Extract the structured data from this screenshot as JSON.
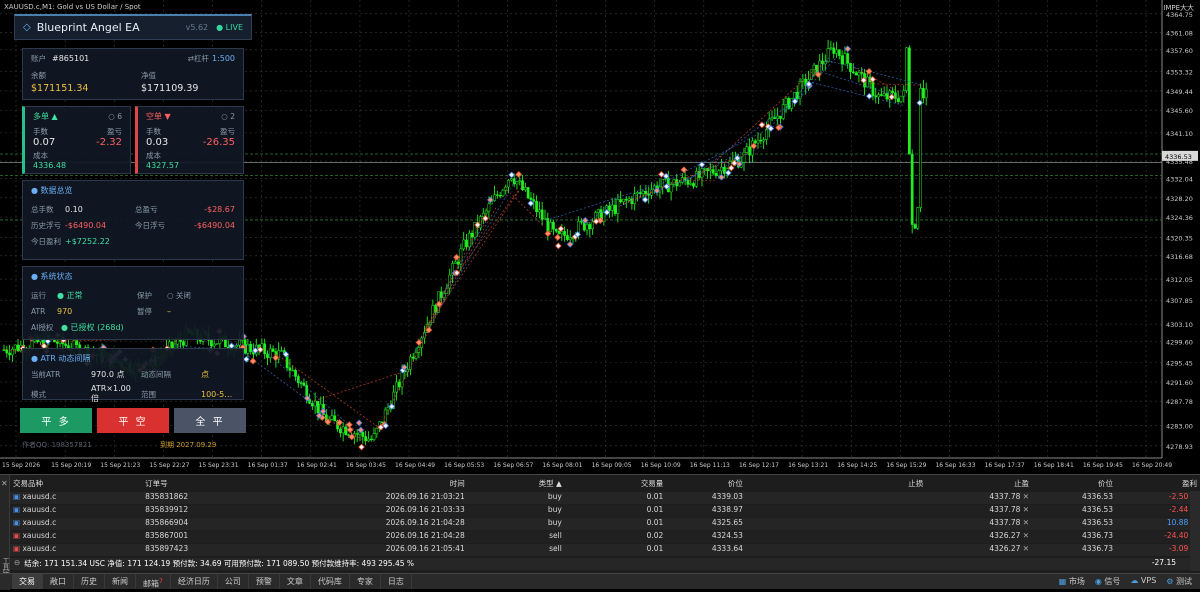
{
  "window": {
    "symbol_title": "XAUUSD.c,M1: Gold vs US Dollar / Spot",
    "top_right": "IMPE大大"
  },
  "ea": {
    "name": "Blueprint Angel EA",
    "version": "v5.62",
    "status": "● LIVE",
    "account_label": "账户",
    "account_no": "#865101",
    "leverage_label": "杠杆",
    "leverage": "1:500",
    "balance_label": "余额",
    "balance": "$171151.34",
    "equity_label": "净值",
    "equity": "$171109.39",
    "long": {
      "title": "多单 ▲",
      "count": "○ 6",
      "lots_label": "手数",
      "lots": "0.07",
      "pl_label": "盈亏",
      "pl": "-2.32",
      "cost_label": "成本",
      "cost": "4336.48"
    },
    "short": {
      "title": "空单 ▼",
      "count": "○ 2",
      "lots_label": "手数",
      "lots": "0.03",
      "pl_label": "盈亏",
      "pl": "-26.35",
      "cost_label": "成本",
      "cost": "4327.57"
    },
    "stats": {
      "title": "● 数据总览",
      "total_lots_label": "总手数",
      "total_lots": "0.10",
      "total_pl_label": "总盈亏",
      "total_pl": "-$28.67",
      "hist_label": "历史浮亏",
      "hist": "-$6490.04",
      "today_float_label": "今日浮亏",
      "today_float": "-$6490.04",
      "today_profit_label": "今日盈利",
      "today_profit": "+$7252.22"
    },
    "system": {
      "title": "● 系统状态",
      "run_label": "运行",
      "run": "● 正常",
      "protect_label": "保护",
      "protect": "○ 关闭",
      "atr_label": "ATR",
      "atr": "970",
      "pause_label": "暂停",
      "pause": "–",
      "ai_label": "AI授权",
      "ai": "● 已授权 (268d)"
    },
    "atr": {
      "title": "● ATR 动态间隔",
      "cur_label": "当前ATR",
      "cur": "970.0 点",
      "dyn_label": "动态间隔",
      "dyn": "点",
      "mode_label": "模式",
      "mode": "ATR×1.00 倍",
      "range_label": "范围",
      "range": "100-5…"
    },
    "buttons": {
      "close_long": "平 多",
      "close_short": "平 空",
      "close_all": "全 平"
    },
    "footer_author": "作者QQ: 198357821",
    "footer_expire": "到期 2027.09.29"
  },
  "chart_data": {
    "type": "candlestick",
    "symbol": "XAUUSD.c",
    "timeframe": "M1",
    "ylim": [
      4276.5,
      4367.5
    ],
    "price_ticks": [
      "4364.75",
      "4361.08",
      "4357.60",
      "4353.32",
      "4349.44",
      "4345.60",
      "4341.10",
      "4335.48",
      "4332.04",
      "4328.20",
      "4324.36",
      "4320.35",
      "4316.68",
      "4312.05",
      "4307.85",
      "4303.10",
      "4299.60",
      "4295.45",
      "4291.60",
      "4287.78",
      "4283.00",
      "4278.93"
    ],
    "time_ticks": [
      "15 Sep 2026",
      "15 Sep 20:19",
      "15 Sep 21:23",
      "15 Sep 22:27",
      "15 Sep 23:31",
      "16 Sep 01:37",
      "16 Sep 02:41",
      "16 Sep 03:45",
      "16 Sep 04:49",
      "16 Sep 05:53",
      "16 Sep 06:57",
      "16 Sep 08:01",
      "16 Sep 09:05",
      "16 Sep 10:09",
      "16 Sep 11:13",
      "16 Sep 12:17",
      "16 Sep 13:21",
      "16 Sep 14:25",
      "16 Sep 15:29",
      "16 Sep 16:33",
      "16 Sep 17:37",
      "16 Sep 18:41",
      "16 Sep 19:45",
      "16 Sep 20:49"
    ],
    "path_x": [
      0,
      5,
      10,
      15,
      20,
      25,
      30,
      35,
      40,
      45,
      50,
      55,
      60,
      65,
      70,
      75,
      80,
      85,
      90,
      95,
      100
    ],
    "path_y": [
      4298,
      4300,
      4297,
      4294,
      4301,
      4299,
      4297,
      4284,
      4280,
      4300,
      4319,
      4333,
      4320,
      4325,
      4330,
      4332,
      4336,
      4347,
      4358,
      4348,
      4349
    ],
    "current_price_label": "4336.53",
    "colors": {
      "candle": "#22ee22",
      "grid": "#3a3a3a",
      "buy_line": "#3a78d8",
      "sell_line": "#e0502a",
      "level_line": "#2e7d32"
    }
  },
  "terminal": {
    "headers": [
      "交易品种",
      "订单号",
      "时间",
      "类型 ▲",
      "交易量",
      "价位",
      "止损",
      "止盈",
      "价位",
      "盈利"
    ],
    "rows": [
      {
        "side": "buy",
        "sym": "xauusd.c",
        "order": "835831862",
        "time": "2026.09.16 21:03:21",
        "type": "buy",
        "vol": "0.01",
        "price": "4339.03",
        "sl": "",
        "tp": "4337.78",
        "cur": "4336.53",
        "profit": "-2.50"
      },
      {
        "side": "buy",
        "sym": "xauusd.c",
        "order": "835839912",
        "time": "2026.09.16 21:03:33",
        "type": "buy",
        "vol": "0.01",
        "price": "4338.97",
        "sl": "",
        "tp": "4337.78",
        "cur": "4336.53",
        "profit": "-2.44"
      },
      {
        "side": "buy",
        "sym": "xauusd.c",
        "order": "835866904",
        "time": "2026.09.16 21:04:28",
        "type": "buy",
        "vol": "0.01",
        "price": "4325.65",
        "sl": "",
        "tp": "4337.78",
        "cur": "4336.53",
        "profit": "10.88"
      },
      {
        "side": "sell",
        "sym": "xauusd.c",
        "order": "835867001",
        "time": "2026.09.16 21:04:28",
        "type": "sell",
        "vol": "0.02",
        "price": "4324.53",
        "sl": "",
        "tp": "4326.27",
        "cur": "4336.73",
        "profit": "-24.40"
      },
      {
        "side": "sell",
        "sym": "xauusd.c",
        "order": "835897423",
        "time": "2026.09.16 21:05:41",
        "type": "sell",
        "vol": "0.01",
        "price": "4333.64",
        "sl": "",
        "tp": "4326.27",
        "cur": "4336.73",
        "profit": "-3.09"
      }
    ],
    "summary": "结余: 171 151.34 USC  净值: 171 124.19  预付款: 34.69  可用预付款: 171 089.50  预付款维持率: 493 295.45 %",
    "summary_total": "-27.15",
    "side_label": "工具箱",
    "tabs": [
      "交易",
      "敞口",
      "历史",
      "新闻",
      "邮箱",
      "经济日历",
      "公司",
      "预警",
      "文章",
      "代码库",
      "专家",
      "日志"
    ],
    "mail_count": "7",
    "right_items": [
      "市场",
      "信号",
      "VPS",
      "测试"
    ]
  }
}
